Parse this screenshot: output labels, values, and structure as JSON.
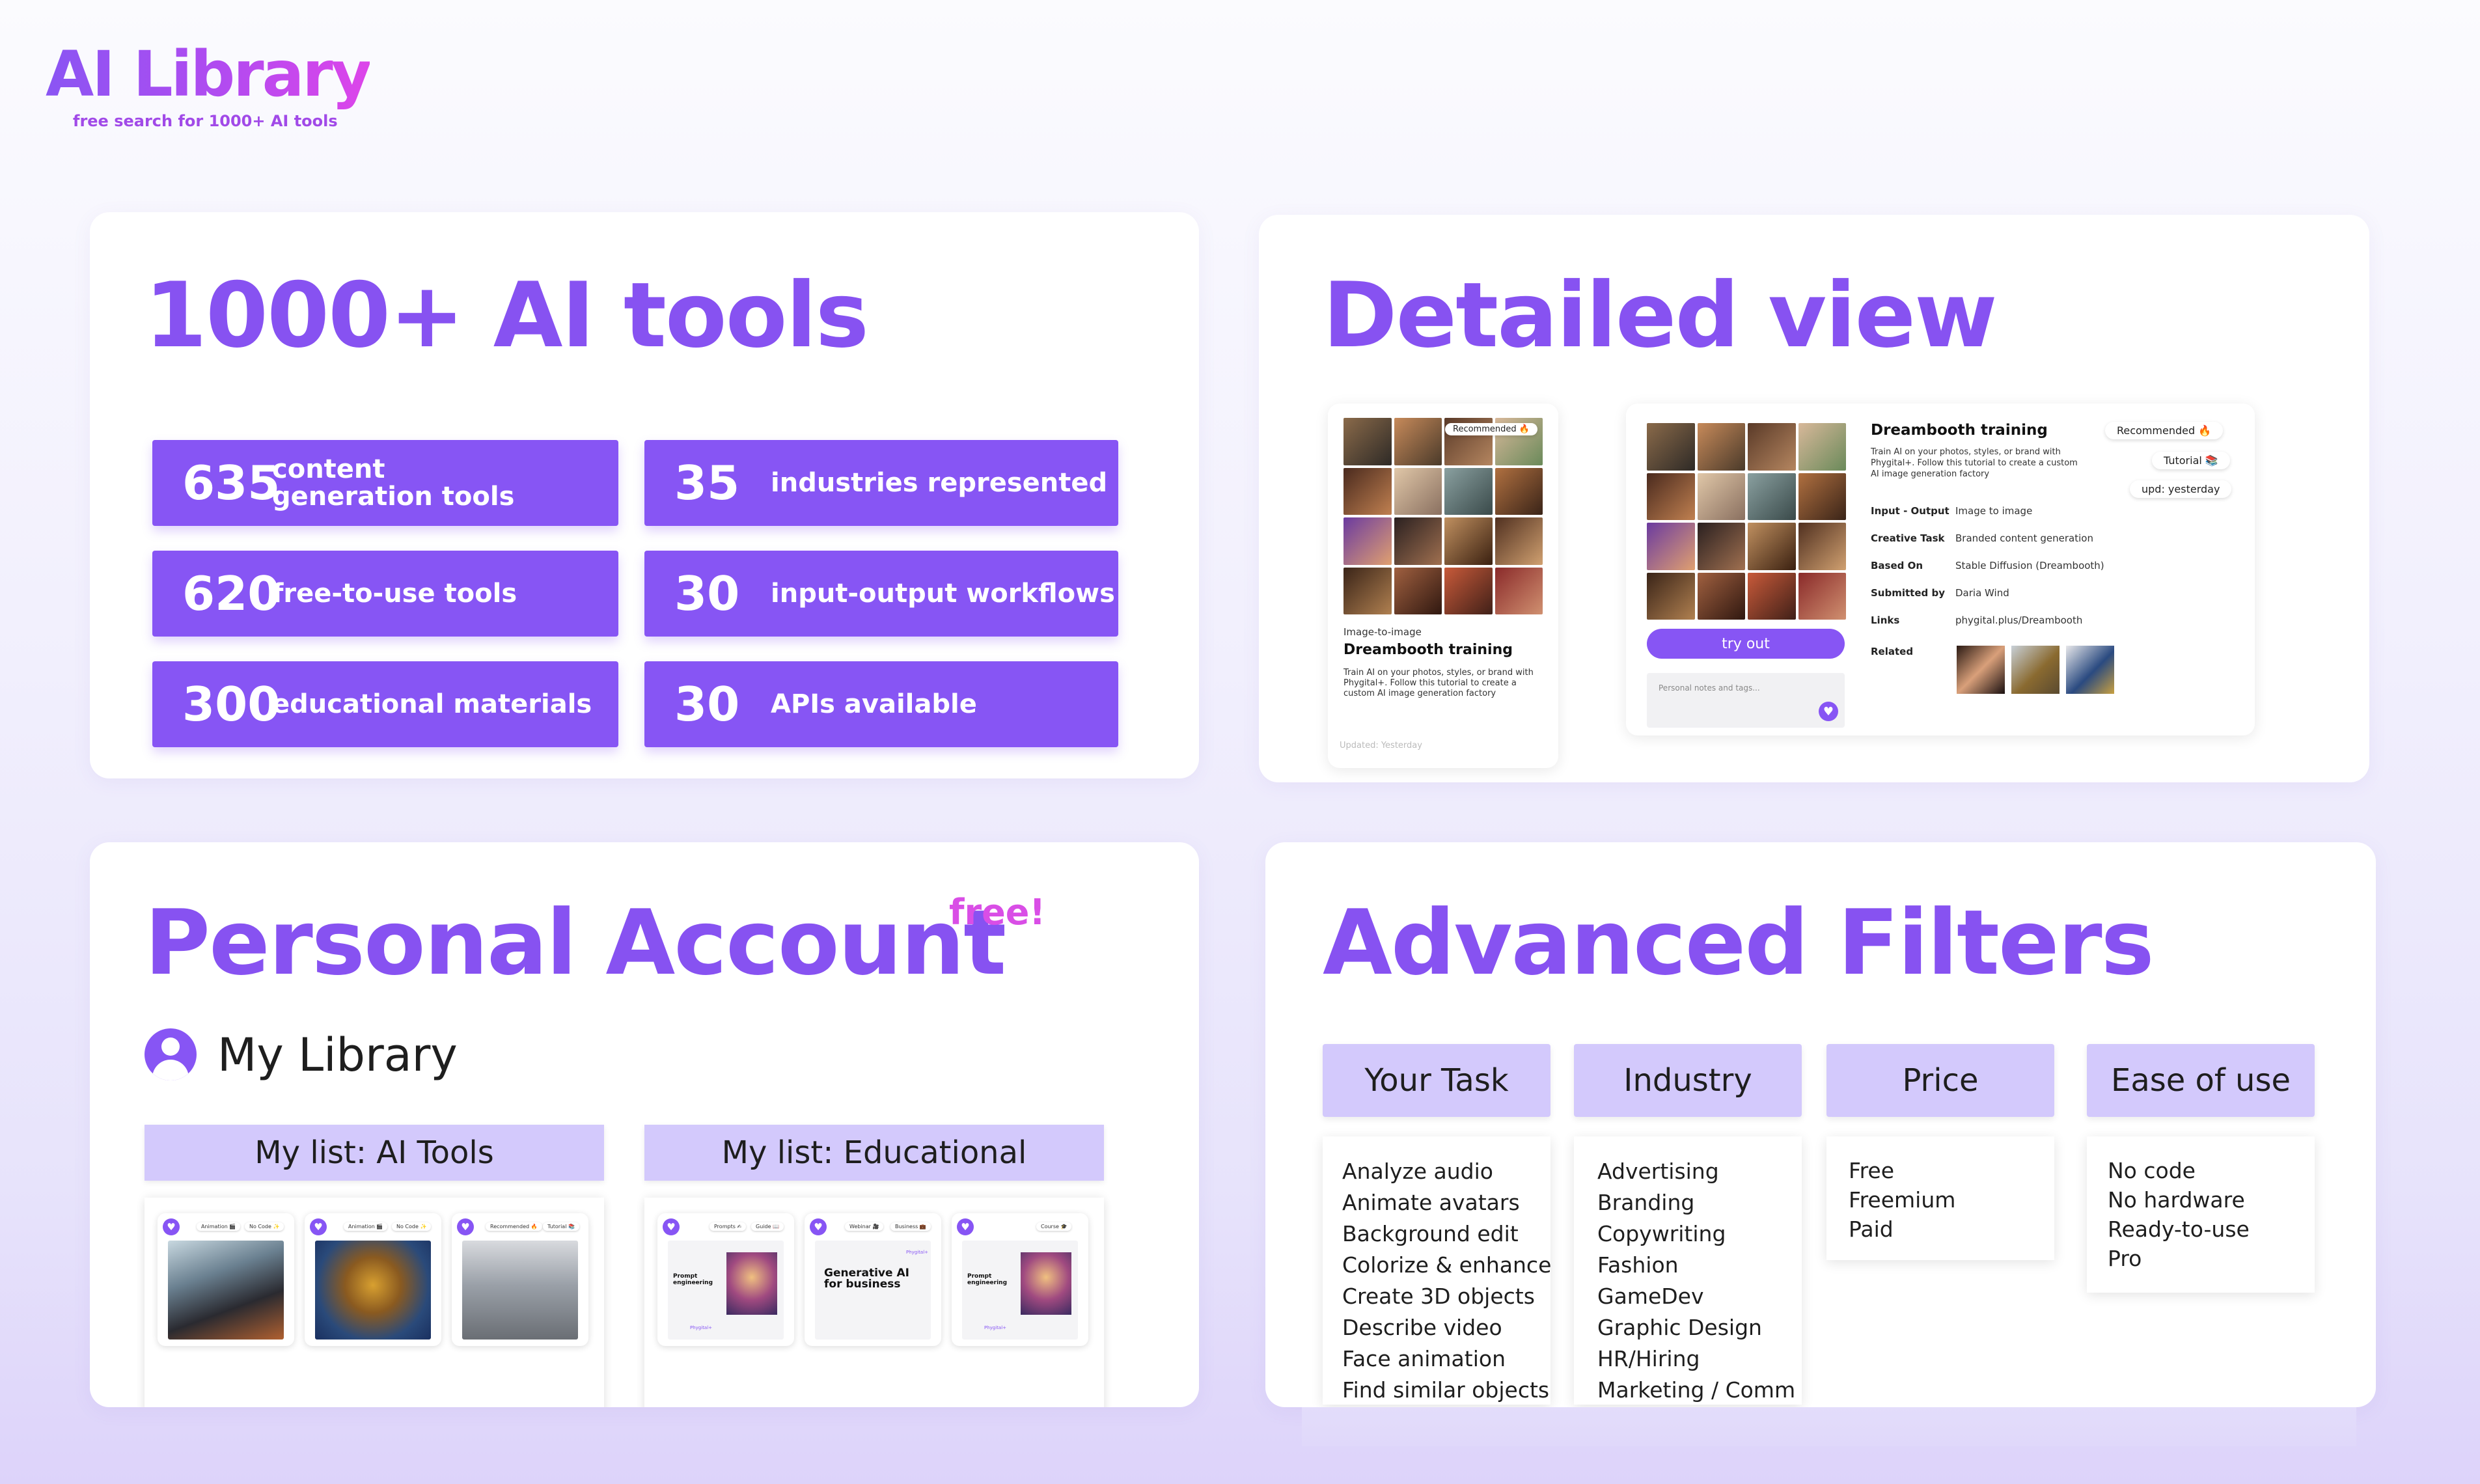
{
  "brand": {
    "title": "AI Library",
    "subtitle": "free search for 1000+ AI tools"
  },
  "tools_card": {
    "title": "1000+ AI tools",
    "stats": [
      {
        "number": "635",
        "label": "content generation tools"
      },
      {
        "number": "35",
        "label": "industries represented"
      },
      {
        "number": "620",
        "label": "free-to-use tools"
      },
      {
        "number": "30",
        "label": "input-output workflows"
      },
      {
        "number": "300",
        "label": "educational materials"
      },
      {
        "number": "30",
        "label": "APIs available"
      }
    ]
  },
  "detail_card": {
    "title": "Detailed view",
    "small": {
      "badge": "Recommended 🔥",
      "category": "Image-to-image",
      "name": "Dreambooth training",
      "description": "Train AI on your photos, styles, or brand with Phygital+. Follow this tutorial to create a custom AI image generation factory",
      "updated": "Updated: Yesterday"
    },
    "large": {
      "name": "Dreambooth training",
      "description": "Train AI on your photos, styles, or brand with Phygital+. Follow this tutorial to create a custom AI image generation factory",
      "pills": [
        "Recommended 🔥",
        "Tutorial 📚",
        "upd: yesterday"
      ],
      "try_button": "try out",
      "notes_placeholder": "Personal notes and tags...",
      "fields": [
        {
          "key": "Input - Output",
          "value": "Image to image"
        },
        {
          "key": "Creative Task",
          "value": "Branded content generation"
        },
        {
          "key": "Based On",
          "value": "Stable Diffusion (Dreambooth)"
        },
        {
          "key": "Submitted by",
          "value": "Daria Wind"
        },
        {
          "key": "Links",
          "value": "phygital.plus/Dreambooth"
        }
      ],
      "related_label": "Related"
    }
  },
  "account_card": {
    "title": "Personal Account",
    "free_badge": "free!",
    "library_label": "My Library",
    "lists": [
      {
        "title": "My list: AI Tools",
        "items": [
          {
            "tags": [
              "Animation 🎬",
              "No Code ✨"
            ]
          },
          {
            "tags": [
              "Animation 🎬",
              "No Code ✨"
            ]
          },
          {
            "tags": [
              "Recommended 🔥",
              "Tutorial 📚"
            ]
          }
        ]
      },
      {
        "title": "My list: Educational",
        "items": [
          {
            "tags": [
              "Prompts ✍",
              "Guide 📖"
            ],
            "heading": "Prompt engineering",
            "brand": "Phygital+"
          },
          {
            "tags": [
              "Webinar 🎥",
              "Business 💼"
            ],
            "heading": "Generative AI for business",
            "brand": "Phygital+"
          },
          {
            "tags": [
              "Course 🎓"
            ],
            "heading": "Prompt engineering",
            "brand": "Phygital+"
          }
        ]
      }
    ]
  },
  "filters_card": {
    "title": "Advanced Filters",
    "columns": [
      {
        "header": "Your Task",
        "items": [
          "Analyze audio",
          "Animate avatars",
          "Background edit",
          "Colorize & enhance",
          "Create 3D objects",
          "Describe video",
          "Face animation",
          "Find similar objects"
        ]
      },
      {
        "header": "Industry",
        "items": [
          "Advertising",
          "Branding",
          "Copywriting",
          "Fashion",
          "GameDev",
          "Graphic Design",
          "HR/Hiring",
          "Marketing / Comm"
        ]
      },
      {
        "header": "Price",
        "items": [
          "Free",
          "Freemium",
          "Paid"
        ]
      },
      {
        "header": "Ease of use",
        "items": [
          "No code",
          "No hardware",
          "Ready-to-use",
          "Pro"
        ]
      }
    ]
  },
  "colors": {
    "accent": "#8755f4",
    "accent_light": "#d3c9fc",
    "free_badge": "#d94ee6"
  }
}
